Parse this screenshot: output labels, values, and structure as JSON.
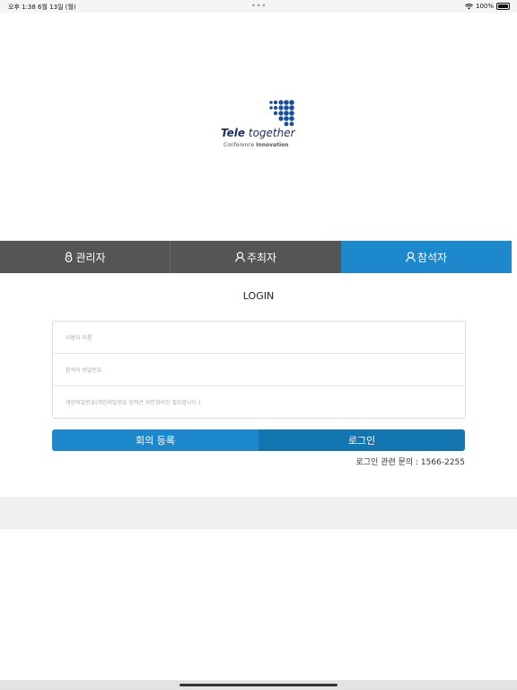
{
  "status_bar": {
    "time_date": "오후 1:38   6월 13일 (월)",
    "dots": "•••",
    "battery": "100%"
  },
  "logo": {
    "brand_bold": "Tele",
    "brand_rest": "together",
    "tagline_1": "Conference",
    "tagline_2": "Innovation"
  },
  "tabs": [
    {
      "label": "관리자",
      "icon": "lock-icon"
    },
    {
      "label": "주최자",
      "icon": "person-icon"
    },
    {
      "label": "참석자",
      "icon": "person-icon",
      "active": true
    }
  ],
  "login_title": "LOGIN",
  "form": {
    "username_placeholder": "사용자 이름",
    "password_placeholder": "참석자 비밀번호",
    "personal_password_placeholder": "개인비밀번호(개인비밀번호 입력은 보안회의만 필요합니다.)"
  },
  "buttons": {
    "register": "회의 등록",
    "login": "로그인"
  },
  "contact": "로그인 관련 문의 : 1566-2255",
  "colors": {
    "accent": "#1e88cc",
    "accent_dark": "#1376b0",
    "tab_inactive": "#555555",
    "brand": "#1a2f5e"
  }
}
